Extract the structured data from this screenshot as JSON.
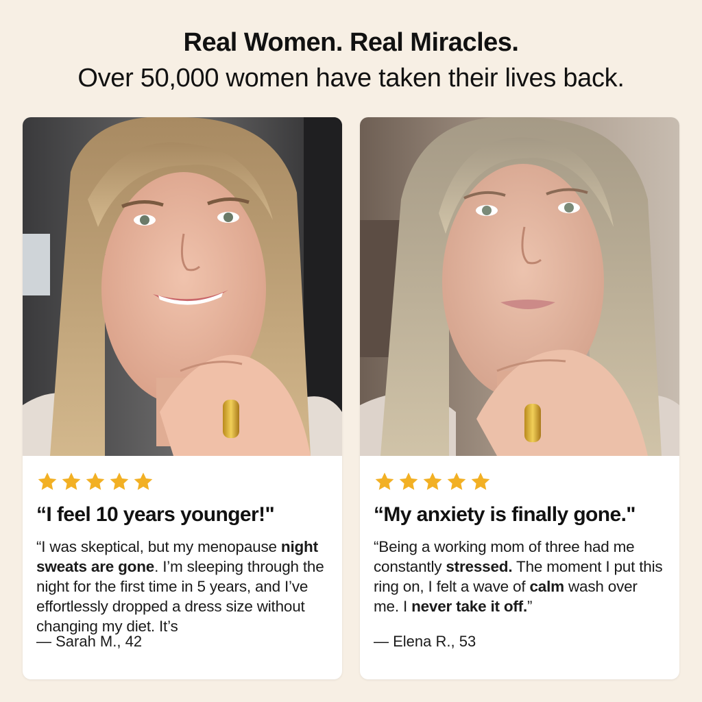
{
  "header": {
    "headline": "Real Women. Real Miracles.",
    "subline": "Over 50,000 women have taken their lives back."
  },
  "colors": {
    "background": "#f7efe4",
    "card": "#ffffff",
    "star": "#f2b024"
  },
  "testimonials": [
    {
      "photo": "woman-smiling-in-car-wearing-gold-ring",
      "rating": 5,
      "title": "“I feel 10 years younger!\"",
      "review": [
        {
          "text": "“I was skeptical, but my menopause ",
          "bold": false
        },
        {
          "text": "night sweats are gone",
          "bold": true
        },
        {
          "text": ". I’m sleeping through the night for the first time in 5 years, and I’ve effortlessly dropped a dress size without changing my diet. It’s",
          "bold": false
        }
      ],
      "author": "— Sarah M., 42"
    },
    {
      "photo": "older-woman-calm-expression-wearing-gold-ring",
      "rating": 5,
      "title": "“My anxiety is finally gone.\"",
      "review": [
        {
          "text": "“Being a working mom of three had me constantly ",
          "bold": false
        },
        {
          "text": "stressed.",
          "bold": true
        },
        {
          "text": " The moment I put this ring on, I felt a wave of ",
          "bold": false
        },
        {
          "text": "calm",
          "bold": true
        },
        {
          "text": " wash over me. I ",
          "bold": false
        },
        {
          "text": "never take it off.",
          "bold": true
        },
        {
          "text": "”",
          "bold": false
        }
      ],
      "author": "— Elena R., 53"
    }
  ]
}
